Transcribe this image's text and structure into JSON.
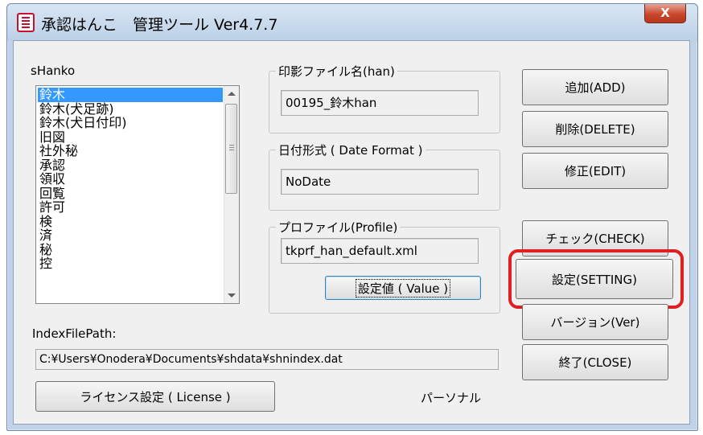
{
  "window": {
    "title": "承認はんこ　管理ツール Ver4.7.7",
    "close_label": "X"
  },
  "hanko_list": {
    "label": "sHanko",
    "items": [
      "鈴木",
      "鈴木(犬足跡)",
      "鈴木(犬日付印)",
      "旧図",
      "社外秘",
      "承認",
      "領収",
      "回覧",
      "許可",
      "検",
      "済",
      "秘",
      "控"
    ],
    "selected_index": 0
  },
  "stamp_file": {
    "caption": "印影ファイル名(han)",
    "value": "00195_鈴木han"
  },
  "date_format": {
    "caption": "日付形式 ( Date Format )",
    "value": "NoDate"
  },
  "profile": {
    "caption": "プロファイル(Profile)",
    "value": "tkprf_han_default.xml",
    "value_button": "設定値 ( Value )"
  },
  "buttons": {
    "add": "追加(ADD)",
    "delete": "削除(DELETE)",
    "edit": "修正(EDIT)",
    "check": "チェック(CHECK)",
    "setting": "設定(SETTING)",
    "version": "バージョン(Ver)",
    "close": "終了(CLOSE)",
    "license": "ライセンス設定 ( License )"
  },
  "index_file": {
    "label": "IndexFilePath:",
    "value": "C:¥Users¥Onodera¥Documents¥shdata¥shnindex.dat"
  },
  "license_type": "パーソナル",
  "colors": {
    "highlight": "#e02020",
    "selection": "#3399ff"
  }
}
